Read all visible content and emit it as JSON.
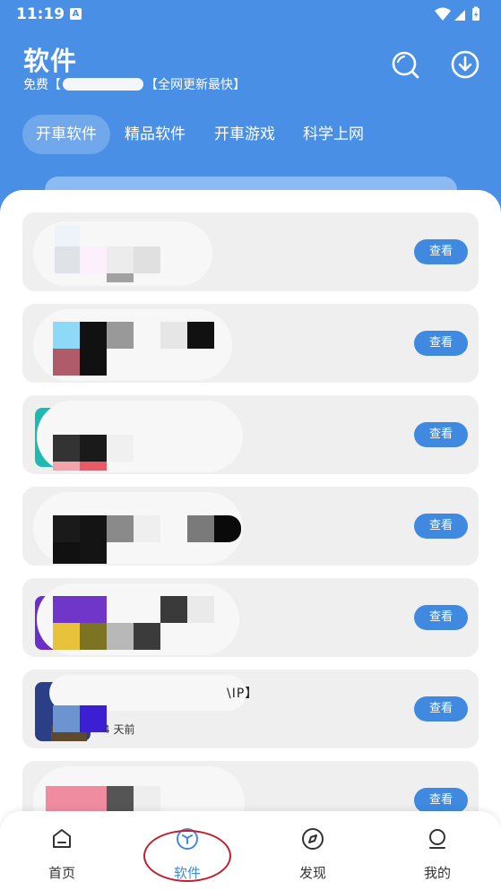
{
  "status_bar": {
    "time": "11:19",
    "notification_letter": "A"
  },
  "header": {
    "title": "软件",
    "subtitle_prefix": "免费【",
    "subtitle_suffix": "【全网更新最快】"
  },
  "tabs": [
    {
      "label": "开車软件",
      "active": true
    },
    {
      "label": "精品软件",
      "active": false
    },
    {
      "label": "开車游戏",
      "active": false
    },
    {
      "label": "科学上网",
      "active": false
    }
  ],
  "list": {
    "view_label": "查看",
    "items": [
      {
        "meta": "",
        "suffix": ""
      },
      {
        "meta": "",
        "suffix": ""
      },
      {
        "meta": "",
        "suffix": ""
      },
      {
        "meta": "",
        "suffix": ""
      },
      {
        "meta": "",
        "suffix": ""
      },
      {
        "meta": "4 天前",
        "suffix": "\\IP】"
      },
      {
        "meta": "",
        "suffix": ""
      }
    ]
  },
  "bottom_nav": [
    {
      "label": "首页",
      "icon": "home-icon",
      "active": false
    },
    {
      "label": "软件",
      "icon": "cube-icon",
      "active": true
    },
    {
      "label": "发现",
      "icon": "compass-icon",
      "active": false
    },
    {
      "label": "我的",
      "icon": "profile-icon",
      "active": false
    }
  ],
  "colors": {
    "primary": "#4a8fe6",
    "button": "#3f8ae0",
    "annotation": "#c0202c"
  }
}
